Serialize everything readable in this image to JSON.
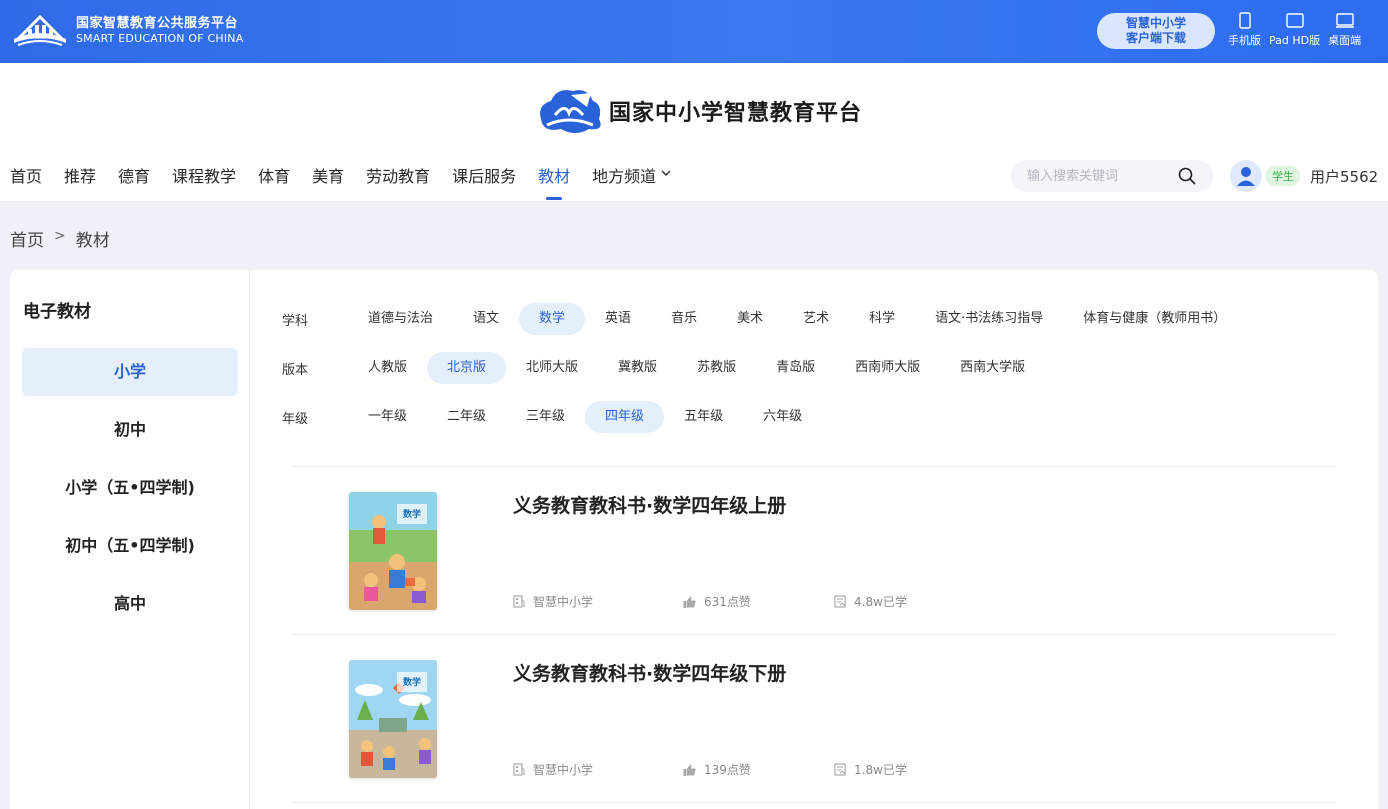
{
  "topbar": {
    "brand_cn": "国家智慧教育公共服务平台",
    "brand_en": "SMART EDUCATION OF CHINA",
    "download_line1": "智慧中小学",
    "download_line2": "客户端下载",
    "devices": [
      {
        "label": "手机版",
        "icon": "phone-icon"
      },
      {
        "label": "Pad HD版",
        "icon": "tablet-icon"
      },
      {
        "label": "桌面端",
        "icon": "desktop-icon"
      }
    ]
  },
  "header": {
    "site_title": "国家中小学智慧教育平台",
    "nav": [
      "首页",
      "推荐",
      "德育",
      "课程教学",
      "体育",
      "美育",
      "劳动教育",
      "课后服务",
      "教材",
      "地方频道"
    ],
    "active_nav": "教材",
    "search_placeholder": "输入搜索关键词",
    "user_role": "学生",
    "user_name": "用户5562"
  },
  "breadcrumb": {
    "home": "首页",
    "sep": ">",
    "current": "教材"
  },
  "sidebar": {
    "title": "电子教材",
    "items": [
      "小学",
      "初中",
      "小学（五•四学制)",
      "初中（五•四学制)",
      "高中"
    ],
    "active": "小学"
  },
  "filters": {
    "subject": {
      "label": "学科",
      "options": [
        "道德与法治",
        "语文",
        "数学",
        "英语",
        "音乐",
        "美术",
        "艺术",
        "科学",
        "语文·书法练习指导",
        "体育与健康（教师用书）"
      ],
      "selected": "数学"
    },
    "edition": {
      "label": "版本",
      "options": [
        "人教版",
        "北京版",
        "北师大版",
        "冀教版",
        "苏教版",
        "青岛版",
        "西南师大版",
        "西南大学版"
      ],
      "selected": "北京版"
    },
    "grade": {
      "label": "年级",
      "options": [
        "一年级",
        "二年级",
        "三年级",
        "四年级",
        "五年级",
        "六年级"
      ],
      "selected": "四年级"
    }
  },
  "books": [
    {
      "title": "义务教育教科书·数学四年级上册",
      "publisher": "智慧中小学",
      "likes": "631点赞",
      "learned": "4.8w已学",
      "cover_title": "数学"
    },
    {
      "title": "义务教育教科书·数学四年级下册",
      "publisher": "智慧中小学",
      "likes": "139点赞",
      "learned": "1.8w已学",
      "cover_title": "数学"
    }
  ],
  "colors": {
    "brand_blue": "#2f6be8",
    "accent": "#2a62d9",
    "selected_bg": "#e5eefb"
  }
}
